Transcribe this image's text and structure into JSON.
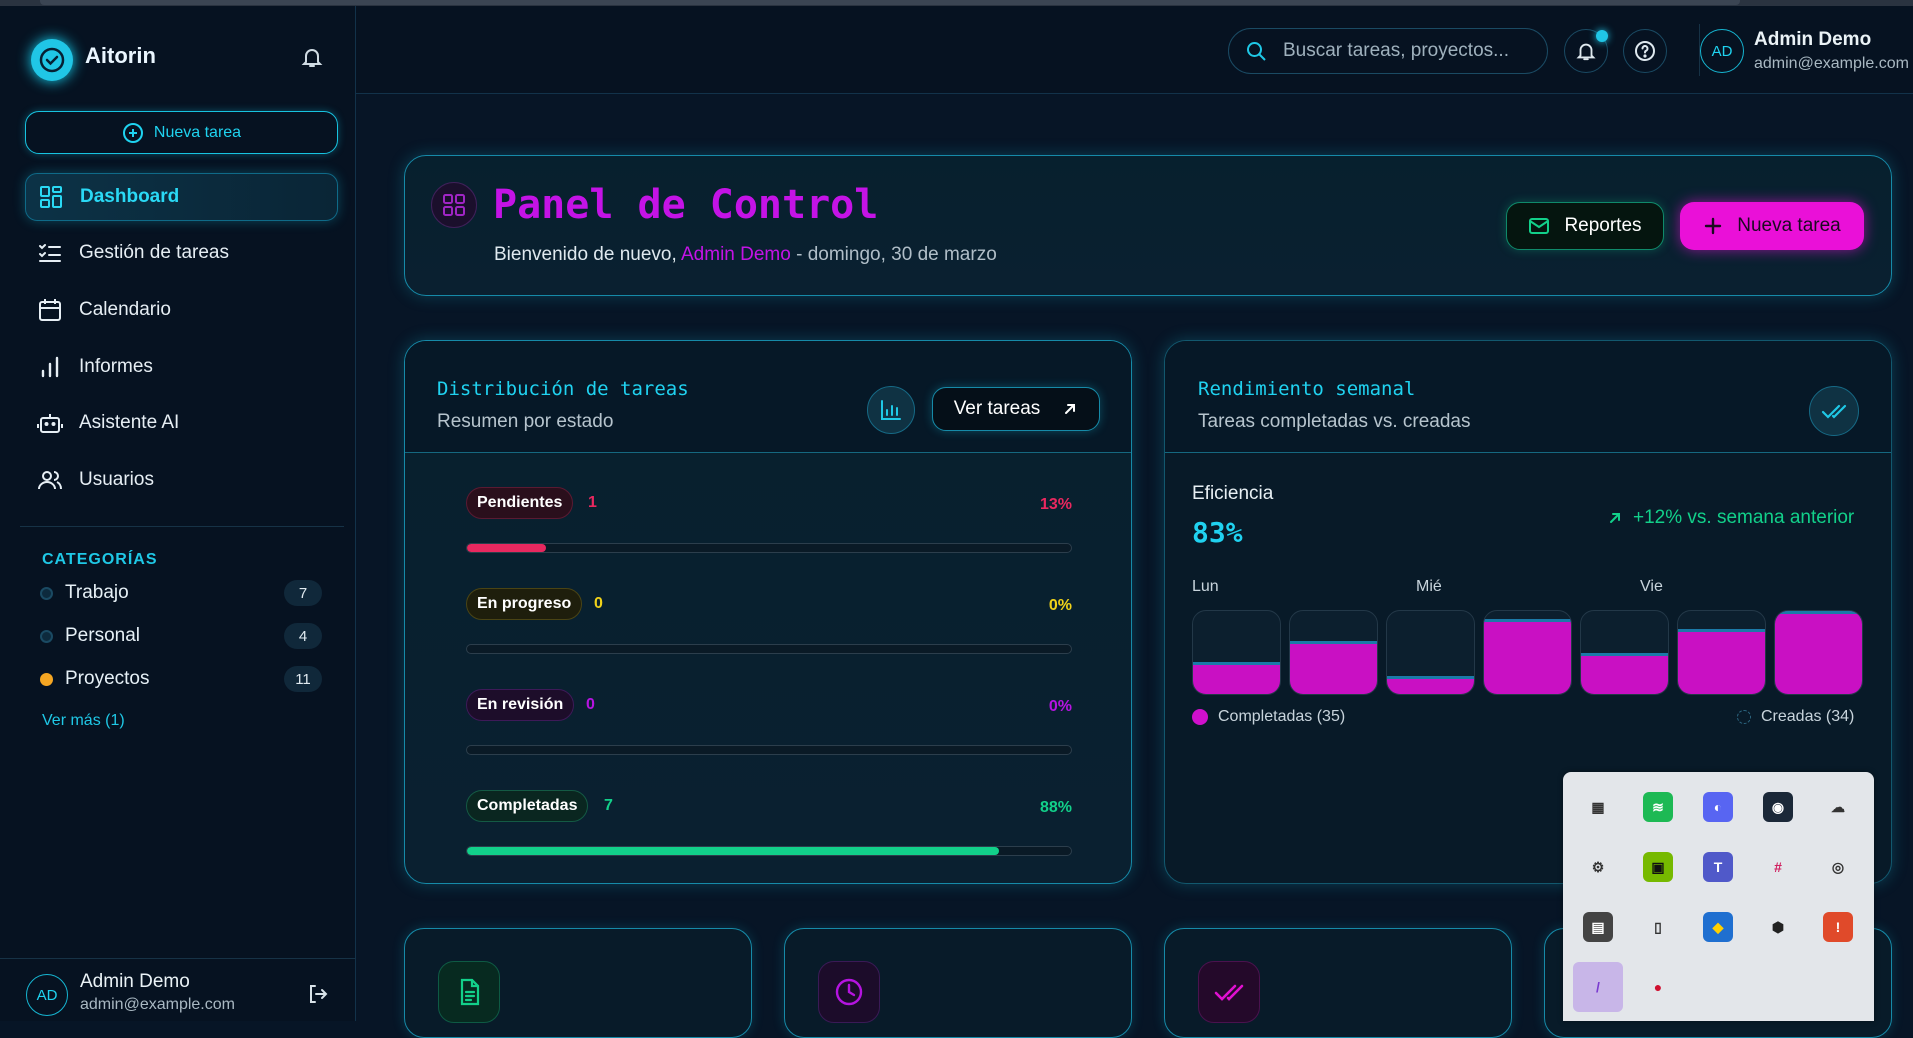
{
  "brand": {
    "name": "Aitorin"
  },
  "sidebar": {
    "new_task_label": "Nueva tarea",
    "items": [
      {
        "label": "Dashboard",
        "icon": "grid-icon",
        "active": true
      },
      {
        "label": "Gestión de tareas",
        "icon": "task-list-icon"
      },
      {
        "label": "Calendario",
        "icon": "calendar-icon"
      },
      {
        "label": "Informes",
        "icon": "bar-chart-icon"
      },
      {
        "label": "Asistente AI",
        "icon": "robot-icon"
      },
      {
        "label": "Usuarios",
        "icon": "users-icon"
      }
    ],
    "categories_title": "CATEGORÍAS",
    "categories": [
      {
        "label": "Trabajo",
        "count": "7",
        "color": "#0d2a3d"
      },
      {
        "label": "Personal",
        "count": "4",
        "color": "#0d2a3d"
      },
      {
        "label": "Proyectos",
        "count": "11",
        "color": "#f5a623"
      }
    ],
    "see_more": "Ver más (1)",
    "user": {
      "initials": "AD",
      "name": "Admin Demo",
      "email": "admin@example.com"
    }
  },
  "header": {
    "search_placeholder": "Buscar tareas, proyectos...",
    "user": {
      "initials": "AD",
      "name": "Admin Demo",
      "email": "admin@example.com"
    }
  },
  "dashboard": {
    "title": "Panel de Control",
    "welcome_prefix": "Bienvenido de nuevo,",
    "welcome_name": "Admin Demo",
    "welcome_suffix": "- domingo, 30 de marzo",
    "reports_label": "Reportes",
    "new_task_label": "Nueva tarea"
  },
  "distribution": {
    "title": "Distribución de tareas",
    "subtitle": "Resumen por estado",
    "view_tasks_label": "Ver tareas",
    "statuses": [
      {
        "label": "Pendientes",
        "count": "1",
        "percent_label": "13%",
        "percent": 13,
        "color": "#e8285f",
        "pill_bg": "#2a0f1c",
        "pill_border": "#5a1a32"
      },
      {
        "label": "En progreso",
        "count": "0",
        "percent_label": "0%",
        "percent": 0,
        "color": "#f0d21a",
        "pill_bg": "#1e1e0c",
        "pill_border": "#4a4414"
      },
      {
        "label": "En revisión",
        "count": "0",
        "percent_label": "0%",
        "percent": 0,
        "color": "#b514e0",
        "pill_bg": "#1d0d2a",
        "pill_border": "#3e1a58"
      },
      {
        "label": "Completadas",
        "count": "7",
        "percent_label": "88%",
        "percent": 88,
        "color": "#12d08a",
        "pill_bg": "#0a2620",
        "pill_border": "#145a44"
      }
    ]
  },
  "weekly": {
    "title": "Rendimiento semanal",
    "subtitle": "Tareas completadas vs. creadas",
    "efficiency_label": "Eficiencia",
    "efficiency_value": "83%",
    "trend": "+12% vs. semana anterior",
    "day_labels": [
      "Lun",
      "Mié",
      "Vie"
    ],
    "completed_fraction": [
      0.38,
      0.64,
      0.22,
      0.9,
      0.5,
      0.78,
      1.0
    ],
    "legend_completed": "Completadas (35)",
    "legend_created": "Creadas (34)"
  },
  "tray": {
    "icons": [
      "grid-dots-icon",
      "spotify-icon",
      "discord-icon",
      "steam-icon",
      "cloud-icon",
      "gear-icon",
      "nvidia-icon",
      "teams-icon",
      "slack-icon",
      "creative-cloud-icon",
      "keyboard-icon",
      "usb-icon",
      "security-shield-icon",
      "shield-hex-icon",
      "notification-badge-icon",
      "pen-icon",
      "app-red-icon"
    ]
  }
}
